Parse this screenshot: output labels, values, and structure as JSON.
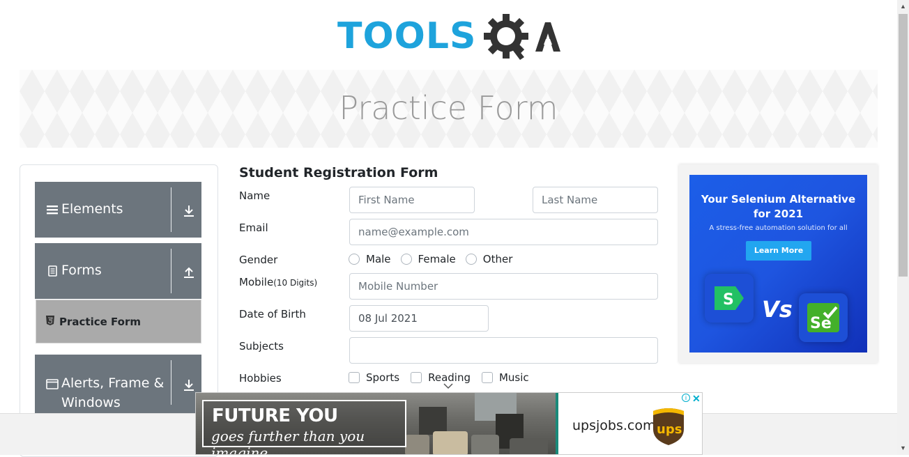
{
  "logo": {
    "text": "TOOLS",
    "text2": "QA"
  },
  "banner": {
    "title": "Practice Form"
  },
  "sidebar": {
    "groups": [
      {
        "label": "Elements",
        "icon": "hamburger-icon",
        "arrow": "download-arrow-icon"
      },
      {
        "label": "Forms",
        "icon": "document-icon",
        "arrow": "upload-arrow-icon"
      },
      {
        "label": "Alerts, Frame &",
        "label2": "Windows",
        "icon": "window-icon",
        "arrow": "download-arrow-icon"
      }
    ],
    "active_item": {
      "label": "Practice Form",
      "icon": "html5-icon"
    }
  },
  "form": {
    "title": "Student Registration Form",
    "name_label": "Name",
    "first_name_placeholder": "First Name",
    "last_name_placeholder": "Last Name",
    "email_label": "Email",
    "email_placeholder": "name@example.com",
    "gender_label": "Gender",
    "gender_options": [
      "Male",
      "Female",
      "Other"
    ],
    "mobile_label": "Mobile",
    "mobile_hint": "(10 Digits)",
    "mobile_placeholder": "Mobile Number",
    "dob_label": "Date of Birth",
    "dob_value": "08 Jul 2021",
    "subjects_label": "Subjects",
    "hobbies_label": "Hobbies",
    "hobby_options": [
      "Sports",
      "Reading",
      "Music"
    ]
  },
  "ad_right": {
    "headline1": "Your Selenium Alternative",
    "headline2": "for 2021",
    "sub": "A stress-free automation solution for all",
    "button": "Learn More",
    "vs": "Vs",
    "left_tile_letter": "S",
    "right_tile_letter": "Se"
  },
  "ad_bottom": {
    "line1": "FUTURE YOU",
    "line2": "goes further than you imagine.",
    "site": "upsjobs.com",
    "brand": "ups",
    "info": "i",
    "close": "✕"
  },
  "colors": {
    "brand_blue": "#1ea3dc",
    "brand_dark": "#333333",
    "sidebar_group": "#6c757d",
    "sidebar_active": "#aaaaaa",
    "ad_blue": "#1c5ee8",
    "ups_brown": "#5a3b1c",
    "ups_gold": "#f5b800"
  }
}
